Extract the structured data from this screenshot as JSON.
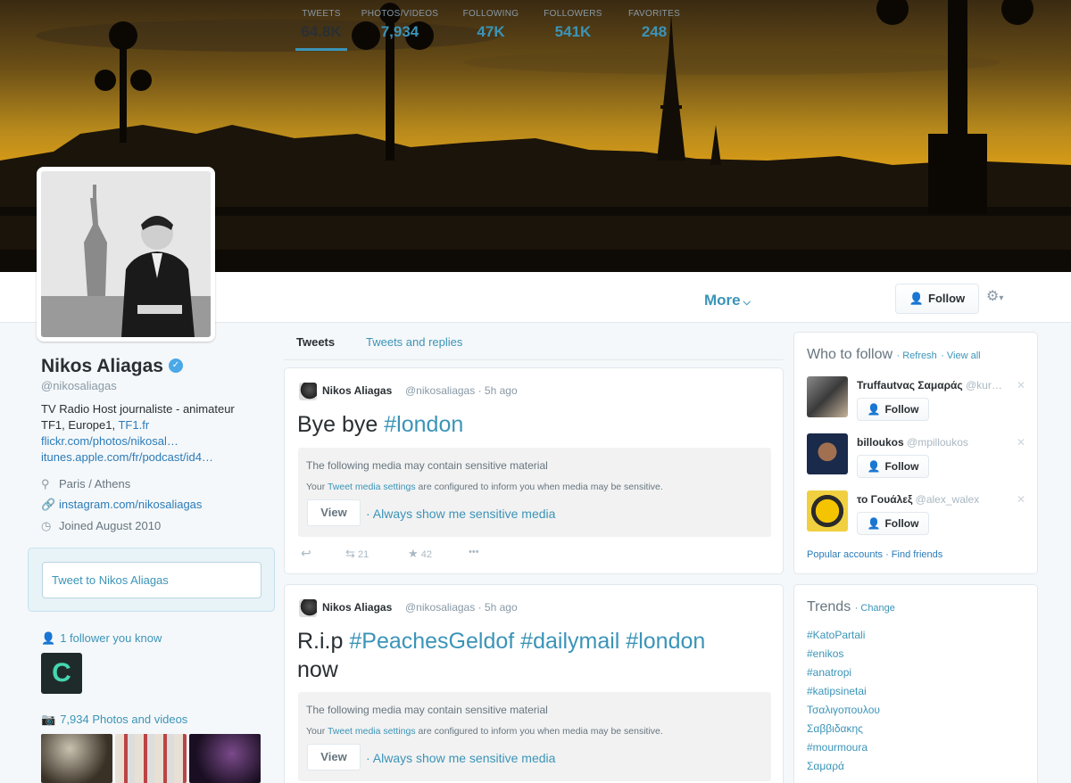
{
  "profile": {
    "name": "Nikos Aliagas",
    "handle": "@nikosaliagas",
    "bio_line1": "TV Radio Host journaliste - animateur",
    "bio_line2_text": "TF1, Europe1, ",
    "bio_line2_link": "TF1.fr",
    "bio_link1": "flickr.com/photos/nikosal…",
    "bio_link2": "itunes.apple.com/fr/podcast/id4…",
    "location": "Paris / Athens",
    "website": "instagram.com/nikosaliagas",
    "joined": "Joined August 2010",
    "tweet_to_placeholder": "Tweet to Nikos Aliagas",
    "followers_you_know": "1 follower you know",
    "photos_videos": "7,934 Photos and videos",
    "known_follower_initial": "C"
  },
  "stats": [
    {
      "label": "TWEETS",
      "value": "64.8K"
    },
    {
      "label": "PHOTOS/VIDEOS",
      "value": "7,934"
    },
    {
      "label": "FOLLOWING",
      "value": "47K"
    },
    {
      "label": "FOLLOWERS",
      "value": "541K"
    },
    {
      "label": "FAVORITES",
      "value": "248"
    }
  ],
  "nav": {
    "more_label": "More",
    "follow_label": "Follow"
  },
  "timeline": {
    "tabs": [
      "Tweets",
      "Tweets and replies"
    ],
    "tweets": [
      {
        "name": "Nikos Aliagas",
        "handle": "@nikosaliagas",
        "time": "· 5h ago",
        "text_plain": "Bye bye ",
        "hashtags": [
          "#london"
        ],
        "replies": "",
        "retweets": "21",
        "favorites": "42"
      },
      {
        "name": "Nikos Aliagas",
        "handle": "@nikosaliagas",
        "time": "· 5h ago",
        "text_plain": "R.i.p ",
        "hashtags": [
          "#PeachesGeldof",
          "#dailymail",
          "#london"
        ],
        "text_end": "now"
      }
    ],
    "sensitive_title": "The following media may contain sensitive material",
    "sensitive_sub_pre": "Your ",
    "sensitive_sub_link": "Tweet media settings",
    "sensitive_sub_post": " are configured to inform you when media may be sensitive.",
    "view_label": "View",
    "always_show": "· Always show me sensitive media",
    "more_dots": "•••"
  },
  "who_to_follow": {
    "title": "Who to follow",
    "refresh": "· Refresh",
    "view_all": "· View all",
    "users": [
      {
        "name": "Truffautvας Σαμαράς",
        "handle": "@kur…"
      },
      {
        "name": "billoukos",
        "handle": "@mpilloukos"
      },
      {
        "name": "το Γουάλεξ",
        "handle": "@alex_walex"
      }
    ],
    "follow_label": "Follow",
    "footer_popular": "Popular accounts",
    "footer_find": "· Find friends"
  },
  "trends": {
    "title": "Trends",
    "change": "· Change",
    "items": [
      "#KatoPartali",
      "#enikos",
      "#anatropi",
      "#katipsinetai",
      "Τσαλιγοπουλου",
      "Σαββιδακης",
      "#mourmoura",
      "Σαμαρά"
    ]
  },
  "colors": {
    "accent": "#3b94b8",
    "link": "#2b7bb9",
    "banner_sky": "#d59a18"
  }
}
